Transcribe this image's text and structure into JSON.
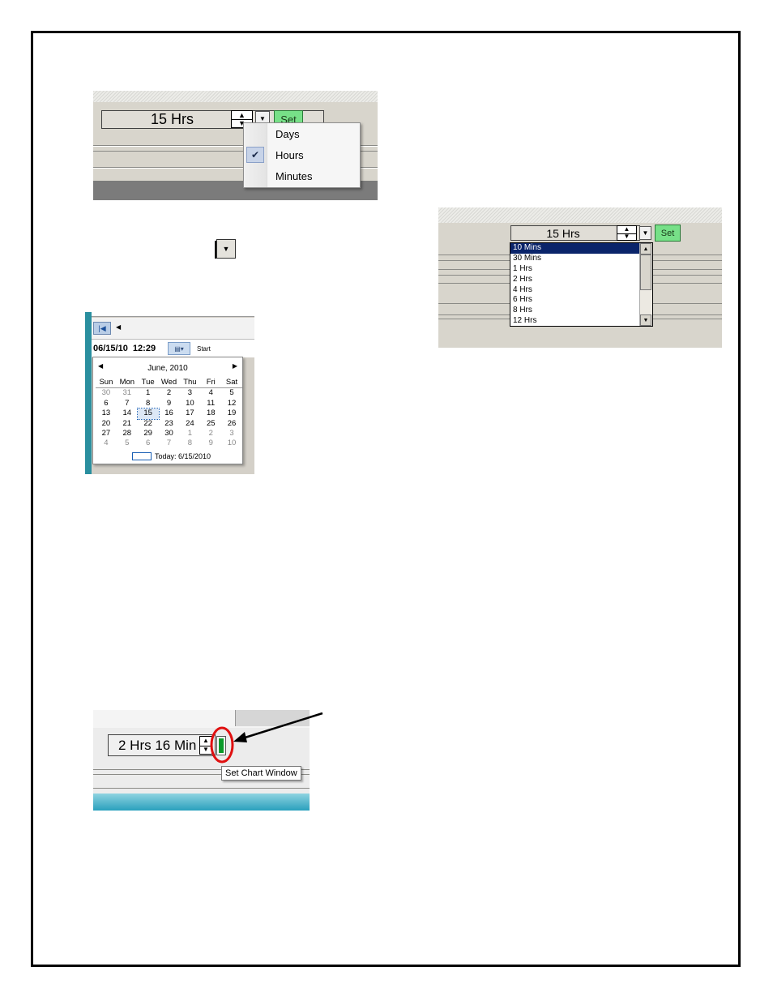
{
  "unit_menu_panel": {
    "duration_text": "15 Hrs",
    "set_label": "Set",
    "menu_items": [
      {
        "label": "Days",
        "checked": false
      },
      {
        "label": "Hours",
        "checked": true
      },
      {
        "label": "Minutes",
        "checked": false
      }
    ]
  },
  "preset_list_panel": {
    "duration_text": "15 Hrs",
    "set_label": "Set",
    "options": [
      "10 Mins",
      "30 Mins",
      "1 Hrs",
      "2 Hrs",
      "4 Hrs",
      "6 Hrs",
      "8 Hrs",
      "12 Hrs"
    ],
    "selected_option": "10 Mins"
  },
  "date_picker_panel": {
    "datetime_value": "06/15/10  12:29",
    "start_label": "Start",
    "month_label": "June, 2010",
    "weekdays": [
      "Sun",
      "Mon",
      "Tue",
      "Wed",
      "Thu",
      "Fri",
      "Sat"
    ],
    "weeks": [
      [
        "30",
        "31",
        "1",
        "2",
        "3",
        "4",
        "5"
      ],
      [
        "6",
        "7",
        "8",
        "9",
        "10",
        "11",
        "12"
      ],
      [
        "13",
        "14",
        "15",
        "16",
        "17",
        "18",
        "19"
      ],
      [
        "20",
        "21",
        "22",
        "23",
        "24",
        "25",
        "26"
      ],
      [
        "27",
        "28",
        "29",
        "30",
        "1",
        "2",
        "3"
      ],
      [
        "4",
        "5",
        "6",
        "7",
        "8",
        "9",
        "10"
      ]
    ],
    "selected_day": "15",
    "today_label": "Today: 6/15/2010"
  },
  "set_chart_panel": {
    "duration_text": "2 Hrs 16 Min",
    "tooltip": "Set Chart Window"
  },
  "colors": {
    "set_button_green": "#77e088",
    "highlight_circle": "#e01010",
    "list_selection": "#0a246a"
  }
}
